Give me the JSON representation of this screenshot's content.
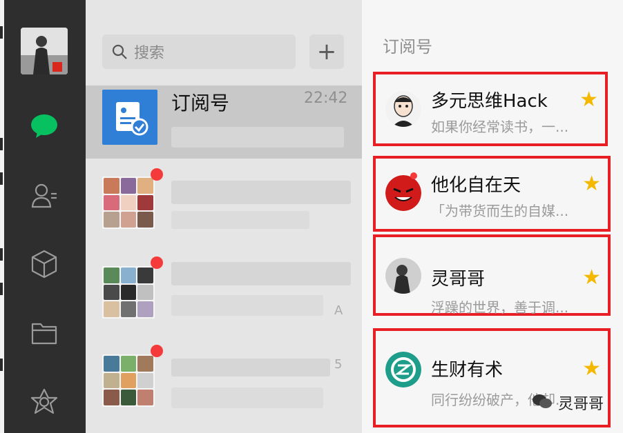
{
  "search": {
    "placeholder": "搜索"
  },
  "toolbar": {
    "add_label": "+"
  },
  "conversation": {
    "title": "订阅号",
    "time": "22:42"
  },
  "group_rows": [
    {
      "preview_hint": ""
    },
    {
      "preview_hint": "A"
    },
    {
      "preview_hint": "5"
    }
  ],
  "subscriptions": {
    "header": "订阅号",
    "items": [
      {
        "name": "多元思维Hack",
        "desc": "如果你经常读书，一...",
        "starred": true
      },
      {
        "name": "他化自在天",
        "desc": "「为带货而生的自媒...",
        "starred": true
      },
      {
        "name": "灵哥哥",
        "desc": "浮躁的世界，善于调...",
        "starred": true
      },
      {
        "name": "生财有术",
        "desc": "同行纷纷破产，他却...",
        "starred": true
      }
    ]
  },
  "watermark": {
    "text": "灵哥哥"
  },
  "colors": {
    "accent": "#07c160",
    "highlight": "#e71e24",
    "star": "#f4b800"
  }
}
